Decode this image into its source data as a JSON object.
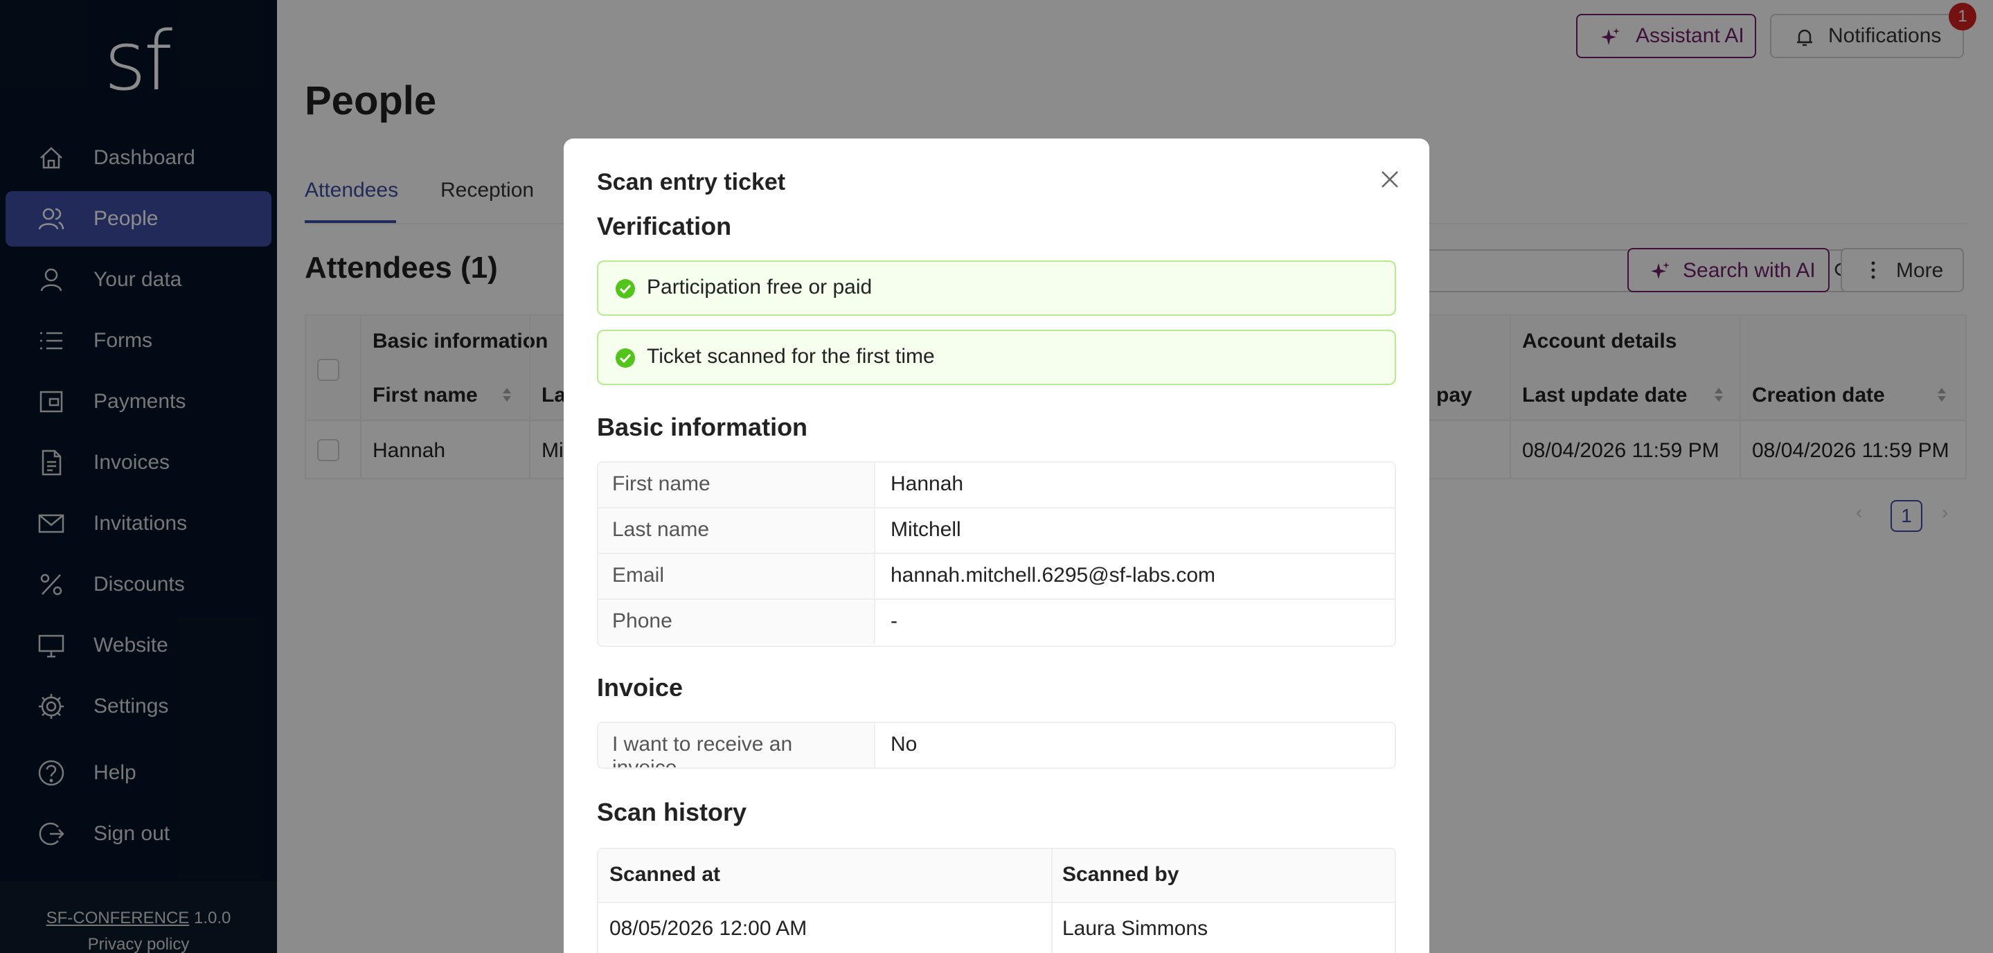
{
  "sidebar": {
    "logo": "sf",
    "items": [
      {
        "label": "Dashboard",
        "icon": "home-icon"
      },
      {
        "label": "People",
        "icon": "people-icon",
        "active": true
      },
      {
        "label": "Your data",
        "icon": "user-icon"
      },
      {
        "label": "Forms",
        "icon": "list-icon"
      },
      {
        "label": "Payments",
        "icon": "wallet-icon"
      },
      {
        "label": "Invoices",
        "icon": "document-icon"
      },
      {
        "label": "Invitations",
        "icon": "mail-icon"
      },
      {
        "label": "Discounts",
        "icon": "percent-icon"
      },
      {
        "label": "Website",
        "icon": "monitor-icon"
      },
      {
        "label": "Settings",
        "icon": "gear-icon"
      },
      {
        "label": "Help",
        "icon": "help-icon"
      },
      {
        "label": "Sign out",
        "icon": "sign-out-icon"
      }
    ],
    "footer": {
      "app_link": "SF-CONFERENCE",
      "version": "1.0.0",
      "privacy": "Privacy policy"
    }
  },
  "header": {
    "assistant_label": "Assistant AI",
    "notifications_label": "Notifications",
    "notifications_count": "1"
  },
  "page": {
    "title": "People",
    "tabs": [
      {
        "label": "Attendees"
      },
      {
        "label": "Reception"
      }
    ],
    "section_title": "Attendees (1)",
    "search_ai_label": "Search with AI",
    "more_label": "More"
  },
  "table": {
    "group_basic": "Basic information",
    "group_account": "Account details",
    "col_first_name": "First name",
    "col_last_name_partial": "La",
    "col_pay_partial": "pay",
    "col_last_update": "Last update date",
    "col_creation": "Creation date",
    "rows": [
      {
        "first_name": "Hannah",
        "last_name_partial": "Mi",
        "last_update": "08/04/2026 11:59 PM",
        "creation": "08/04/2026 11:59 PM"
      }
    ],
    "current_page": "1"
  },
  "modal": {
    "title": "Scan entry ticket",
    "verification_title": "Verification",
    "checks": [
      {
        "text": "Participation free or paid",
        "status": "ok"
      },
      {
        "text": "Ticket scanned for the first time",
        "status": "ok"
      }
    ],
    "basic_title": "Basic information",
    "basic_fields": [
      {
        "key": "First name",
        "value": "Hannah"
      },
      {
        "key": "Last name",
        "value": "Mitchell"
      },
      {
        "key": "Email",
        "value": "hannah.mitchell.6295@sf-labs.com"
      },
      {
        "key": "Phone",
        "value": "-"
      }
    ],
    "invoice_title": "Invoice",
    "invoice_fields": [
      {
        "key": "I want to receive an invoice",
        "value": "No"
      }
    ],
    "history_title": "Scan history",
    "history_cols": [
      "Scanned at",
      "Scanned by"
    ],
    "history_rows": [
      {
        "scanned_at": "08/05/2026 12:00 AM",
        "scanned_by": "Laura Simmons"
      }
    ]
  },
  "colors": {
    "sidebar_bg": "#051427",
    "active_nav": "#3d4ea0",
    "ai_accent": "#701f6a",
    "success_border": "#b6eb8f",
    "success_bg": "#f6ffed",
    "success_icon": "#52c41a",
    "badge": "#d42020"
  }
}
